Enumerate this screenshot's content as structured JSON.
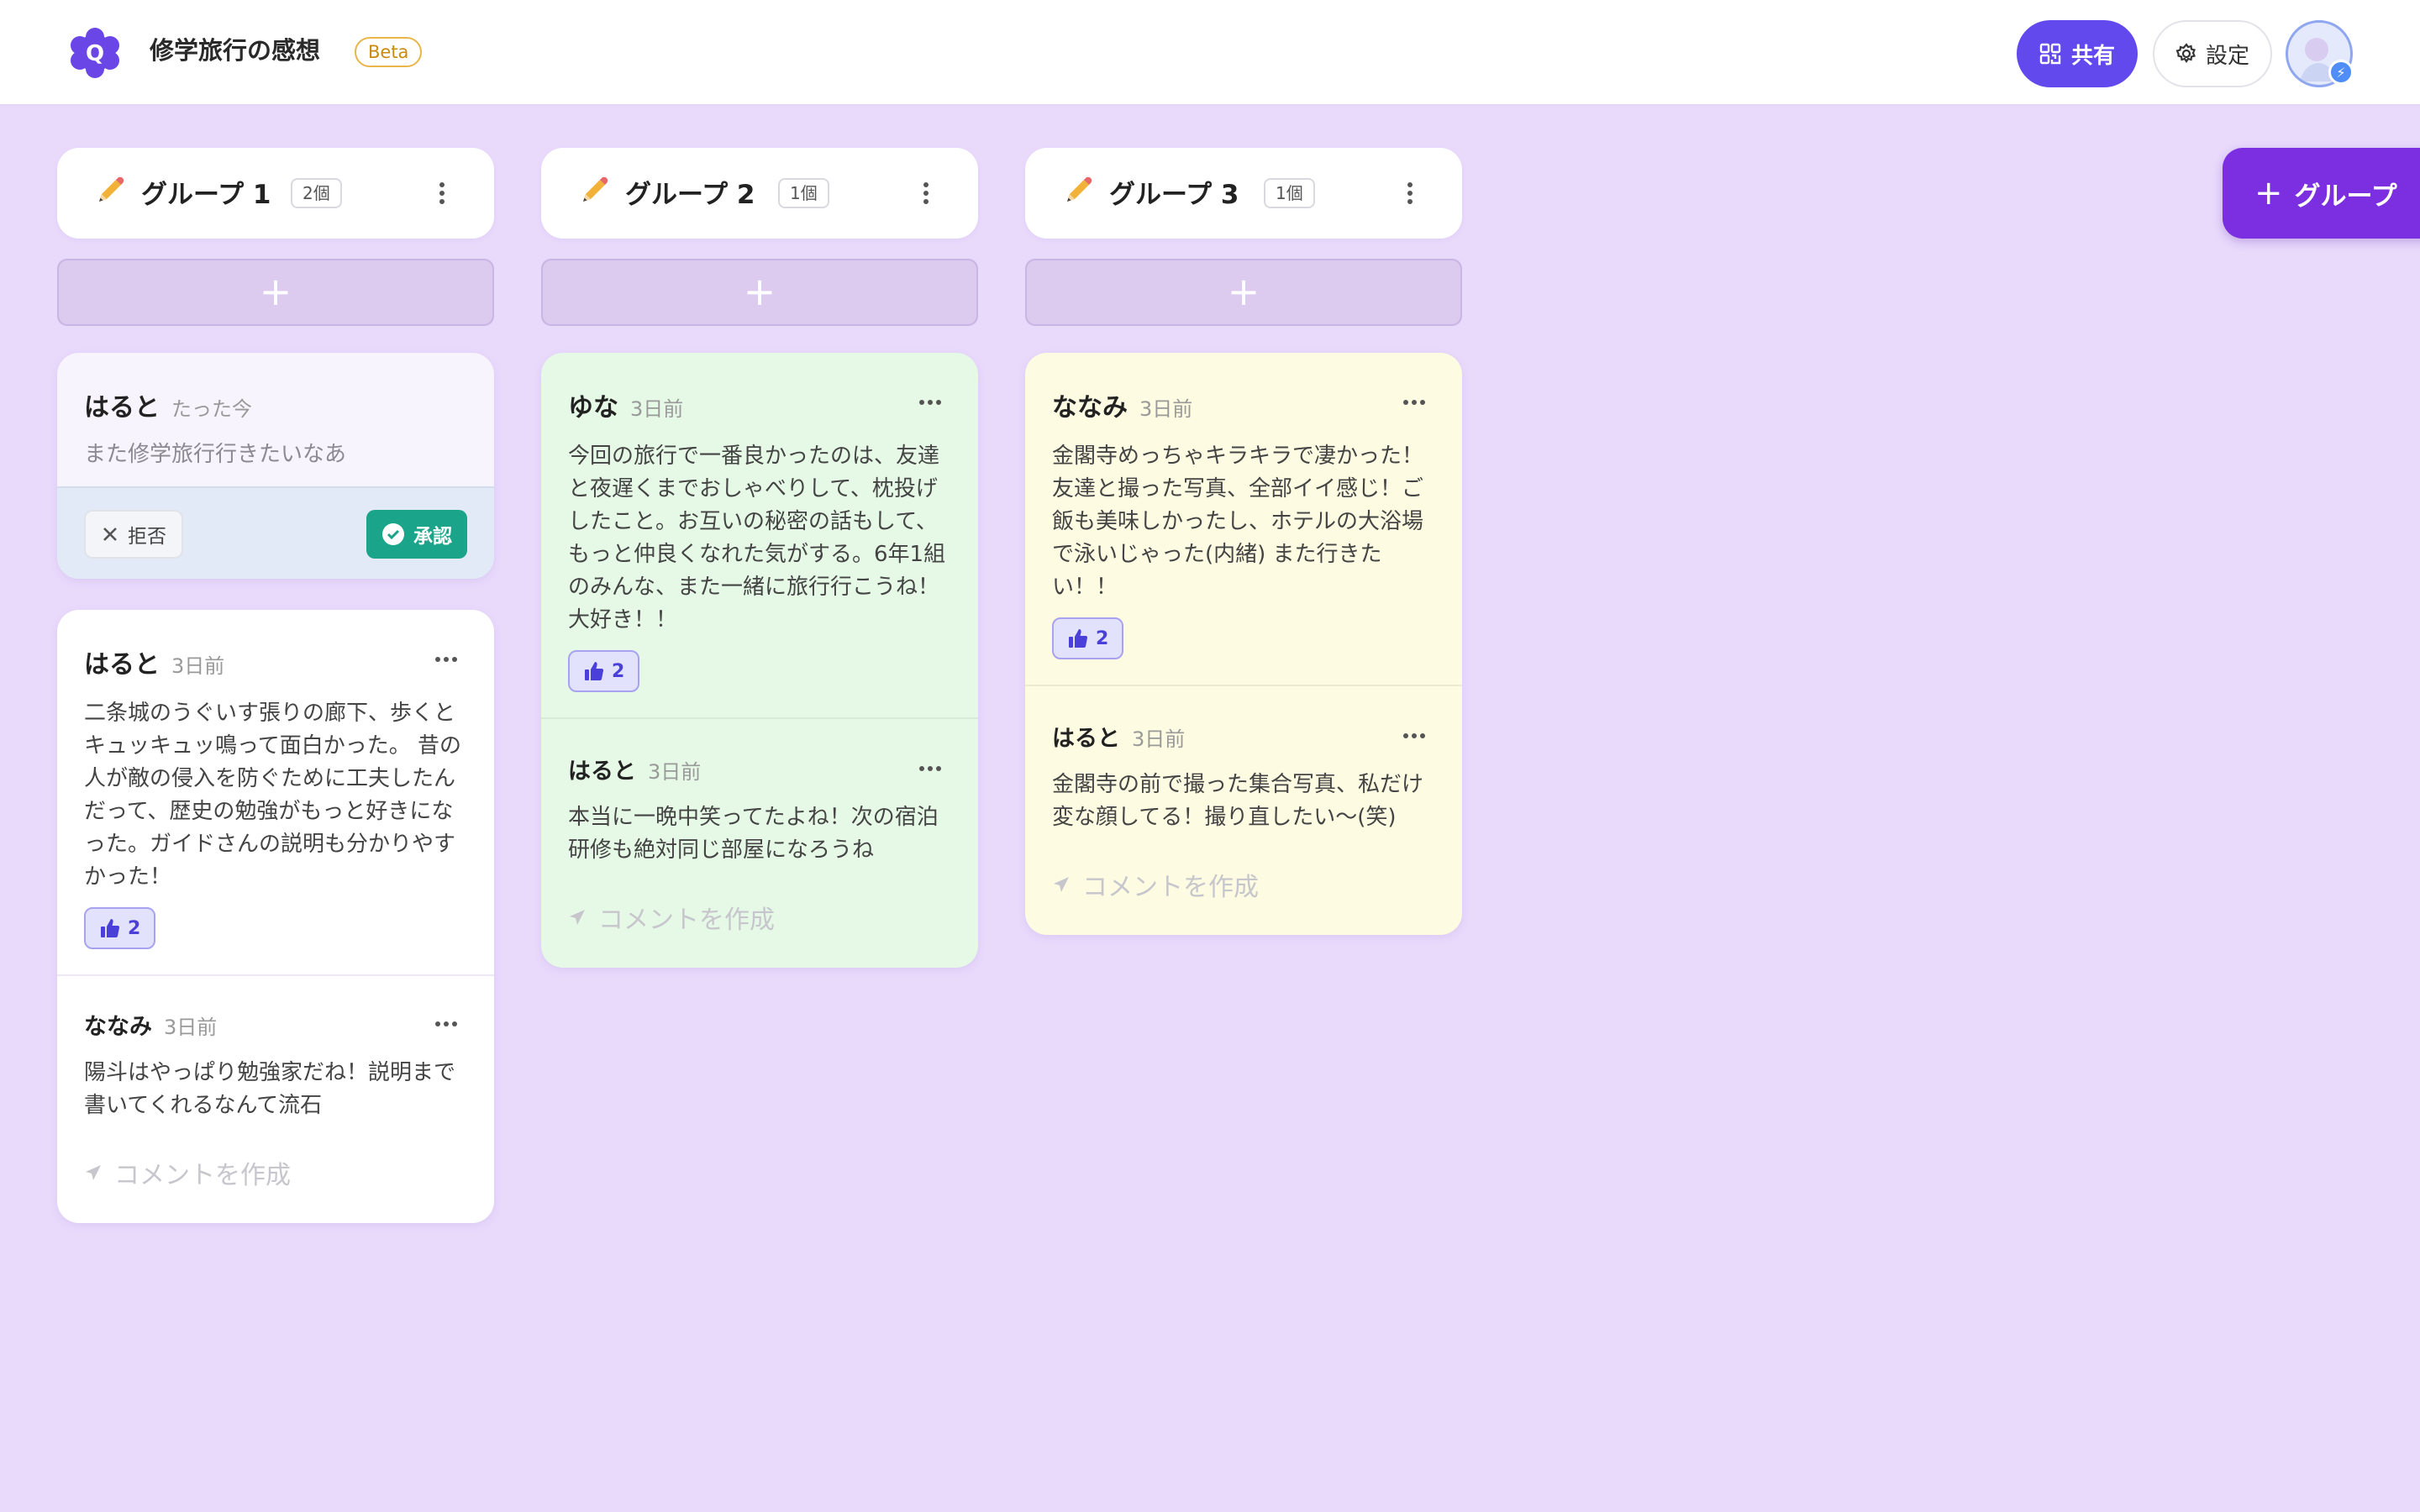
{
  "app": {
    "title": "修学旅行の感想",
    "badge": "Beta"
  },
  "header": {
    "share_label": "共有",
    "settings_label": "設定"
  },
  "add_group_label": "グループ",
  "comment_placeholder": "コメントを作成",
  "pending_actions": {
    "reject_label": "拒否",
    "approve_label": "承認"
  },
  "columns": [
    {
      "name": "グループ 1",
      "count": "2個",
      "pending": {
        "author": "はると",
        "time": "たった今",
        "text": "また修学旅行行きたいなあ"
      },
      "post": {
        "author": "はると",
        "time": "3日前",
        "text": "二条城のうぐいす張りの廊下、歩くとキュッキュッ鳴って面白かった。 昔の人が敵の侵入を防ぐために工夫したんだって、歴史の勉強がもっと好きになった。ガイドさんの説明も分かりやすかった！",
        "likes": "2"
      },
      "comment": {
        "author": "ななみ",
        "time": "3日前",
        "text": "陽斗はやっぱり勉強家だね！説明まで書いてくれるなんて流石"
      }
    },
    {
      "name": "グループ 2",
      "count": "1個",
      "post": {
        "author": "ゆな",
        "time": "3日前",
        "text": "今回の旅行で一番良かったのは、友達と夜遅くまでおしゃべりして、枕投げしたこと。お互いの秘密の話もして、もっと仲良くなれた気がする。6年1組のみんな、また一緒に旅行行こうね！大好き！！",
        "likes": "2"
      },
      "comment": {
        "author": "はると",
        "time": "3日前",
        "text": "本当に一晩中笑ってたよね！次の宿泊研修も絶対同じ部屋になろうね"
      }
    },
    {
      "name": "グループ 3",
      "count": "1個",
      "post": {
        "author": "ななみ",
        "time": "3日前",
        "text": "金閣寺めっちゃキラキラで凄かった！友達と撮った写真、全部イイ感じ！ご飯も美味しかったし、ホテルの大浴場で泳いじゃった(内緒)  また行きたい！！",
        "likes": "2"
      },
      "comment": {
        "author": "はると",
        "time": "3日前",
        "text": "金閣寺の前で撮った集合写真、私だけ変な顔してる！撮り直したい〜(笑)"
      }
    }
  ],
  "colors": {
    "background": "#e9dafc",
    "accent": "#6149ee",
    "add_group": "#7b2fe0",
    "approve": "#1aa58a",
    "group1_card": "#ffffff",
    "group2_card": "#e6f9e6",
    "group3_card": "#fdfbe1",
    "pending_card": "#f8f4fd"
  },
  "icons": {
    "logo": "q-flower-logo",
    "share": "qr-code-icon",
    "settings": "gear-icon",
    "pencil": "pencil-icon",
    "more": "kebab-icon",
    "post_more": "ellipsis-icon",
    "like": "thumbs-up-icon",
    "send": "send-icon",
    "reject": "close-icon",
    "approve": "check-circle-icon",
    "add": "plus-icon"
  }
}
